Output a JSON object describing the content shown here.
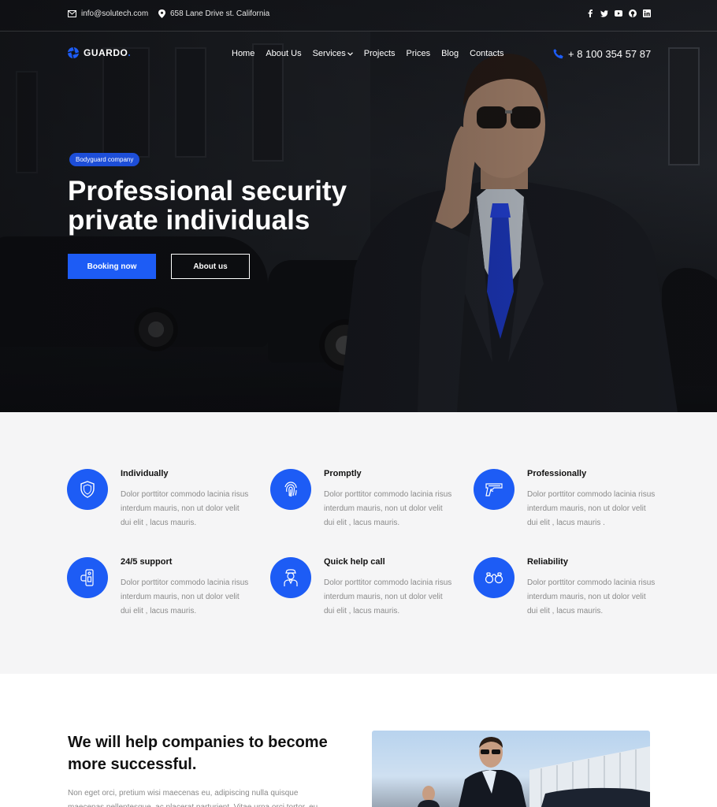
{
  "topbar": {
    "email": "info@solutech.com",
    "address": "658 Lane Drive st. California",
    "socials": [
      "facebook-icon",
      "twitter-icon",
      "youtube-icon",
      "github-icon",
      "linkedin-icon"
    ]
  },
  "brand": {
    "name": "GUARDO",
    "dot": ".",
    "accent": "#1d5cf5"
  },
  "nav": {
    "items": [
      "Home",
      "About Us",
      "Services",
      "Projects",
      "Prices",
      "Blog",
      "Contacts"
    ],
    "phone": "+ 8 100 354 57 87"
  },
  "hero": {
    "badge": "Bodyguard company",
    "title_line1": "Professional security",
    "title_line2": "private individuals",
    "primary_button": "Booking now",
    "secondary_button": "About us"
  },
  "features": [
    {
      "title": "Individually",
      "text": "Dolor porttitor commodo lacinia risus interdum mauris, non ut dolor velit dui elit , lacus mauris.",
      "icon": "shield-icon"
    },
    {
      "title": "Promptly",
      "text": "Dolor porttitor commodo lacinia risus interdum mauris, non ut dolor velit dui elit , lacus mauris.",
      "icon": "fingerprint-icon"
    },
    {
      "title": "Professionally",
      "text": "Dolor porttitor commodo lacinia risus interdum mauris, non ut dolor velit dui elit , lacus mauris .",
      "icon": "pistol-icon"
    },
    {
      "title": "24/5 support",
      "text": "Dolor porttitor commodo lacinia risus interdum mauris, non ut dolor velit dui elit , lacus mauris.",
      "icon": "intercom-icon"
    },
    {
      "title": "Quick help call",
      "text": "Dolor porttitor commodo lacinia risus interdum mauris, non ut dolor velit dui elit , lacus mauris.",
      "icon": "guard-icon"
    },
    {
      "title": "Reliability",
      "text": "Dolor porttitor commodo lacinia risus interdum mauris, non ut dolor velit dui elit , lacus mauris.",
      "icon": "handcuffs-icon"
    }
  ],
  "about": {
    "title": "We will help companies to become more successful.",
    "text": "Non eget orci, pretium wisi maecenas eu, adipiscing nulla quisque maecenas pellentesque, ac placerat parturient. Vitae urna orci tortor, eu"
  }
}
